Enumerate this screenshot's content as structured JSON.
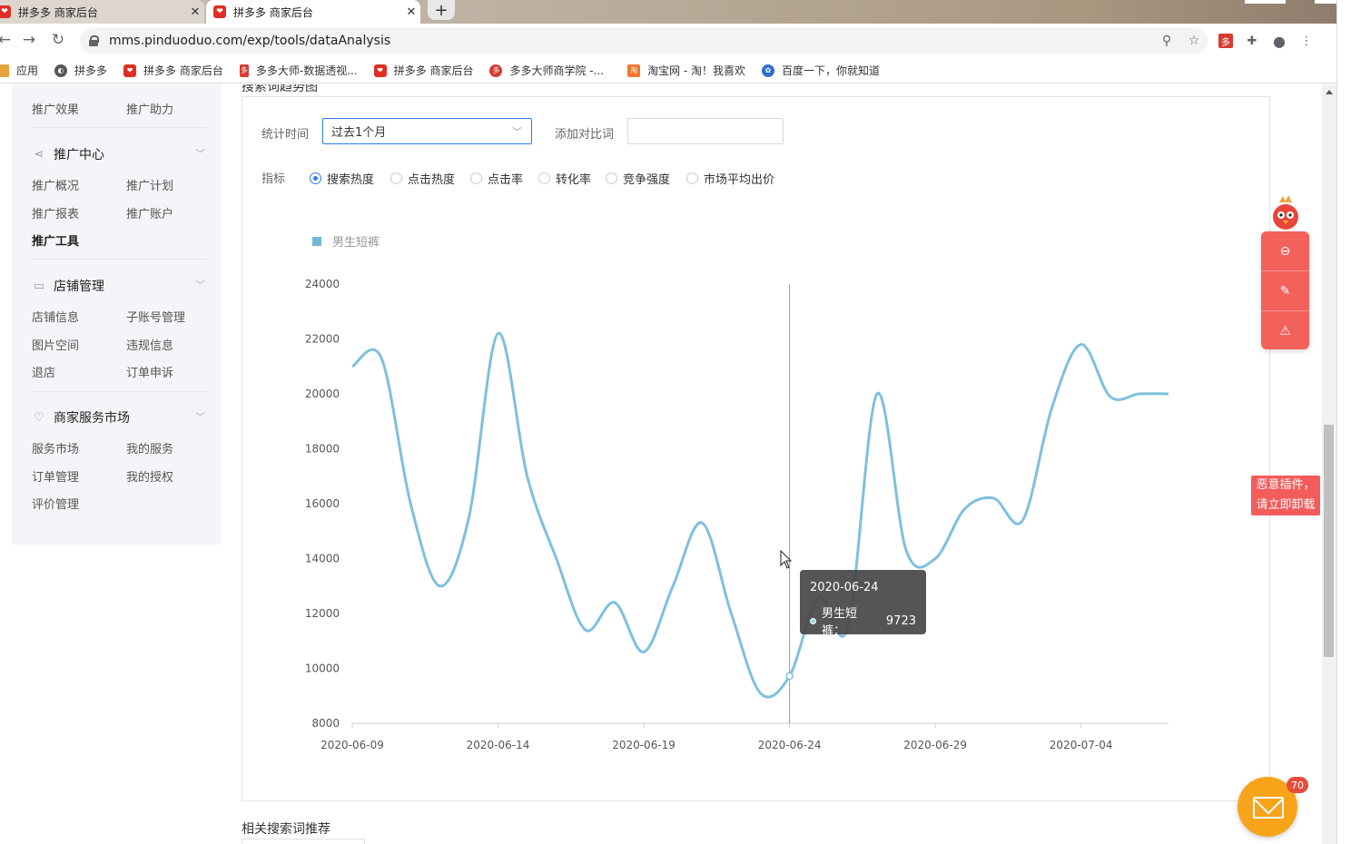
{
  "browser": {
    "tabs": [
      {
        "title": "拼多多 商家后台",
        "active": false
      },
      {
        "title": "拼多多 商家后台",
        "active": true
      }
    ],
    "new_tab": "+",
    "url": "mms.pinduoduo.com/exp/tools/dataAnalysis",
    "bookmarks": [
      {
        "label": "应用",
        "icon": "apps-grid-icon",
        "color": "#e8a33d"
      },
      {
        "label": "拼多多",
        "icon": "globe-icon",
        "color": "#555555"
      },
      {
        "label": "拼多多 商家后台",
        "icon": "pdd-icon",
        "color": "#e02e24"
      },
      {
        "label": "多多大师-数据透视...",
        "icon": "duoduo-master-icon",
        "color": "#d43c33"
      },
      {
        "label": "拼多多 商家后台",
        "icon": "pdd-icon",
        "color": "#e02e24"
      },
      {
        "label": "多多大师商学院 -...",
        "icon": "academy-icon",
        "color": "#d43c33"
      },
      {
        "label": "淘宝网 - 淘！我喜欢",
        "icon": "taobao-icon",
        "color": "#f5742d"
      },
      {
        "label": "百度一下，你就知道",
        "icon": "baidu-paw-icon",
        "color": "#2e6cd1"
      }
    ]
  },
  "sidebar": {
    "top_items": [
      "推广效果",
      "推广助力"
    ],
    "groups": [
      {
        "title": "推广中心",
        "icon": "share-icon",
        "items": [
          "推广概况",
          "推广计划",
          "推广报表",
          "推广账户",
          "推广工具"
        ],
        "active": "推广工具"
      },
      {
        "title": "店铺管理",
        "icon": "store-icon",
        "items": [
          "店铺信息",
          "子账号管理",
          "图片空间",
          "违规信息",
          "退店",
          "订单申诉"
        ]
      },
      {
        "title": "商家服务市场",
        "icon": "heart-icon",
        "items": [
          "服务市场",
          "我的服务",
          "订单管理",
          "我的授权",
          "评价管理"
        ]
      }
    ]
  },
  "content": {
    "section_title": "搜索词趋势图",
    "time_label": "统计时间",
    "time_value": "过去1个月",
    "compare_label": "添加对比词",
    "compare_value": "",
    "metric_label": "指标",
    "metrics": [
      "搜索热度",
      "点击热度",
      "点击率",
      "转化率",
      "竞争强度",
      "市场平均出价"
    ],
    "metric_selected": "搜索热度",
    "related_title": "相关搜索词推荐"
  },
  "chart_data": {
    "type": "line",
    "series": [
      {
        "name": "男生短裤",
        "color": "#7ec0de",
        "x": [
          "2020-06-09",
          "2020-06-10",
          "2020-06-11",
          "2020-06-12",
          "2020-06-13",
          "2020-06-14",
          "2020-06-15",
          "2020-06-16",
          "2020-06-17",
          "2020-06-18",
          "2020-06-19",
          "2020-06-20",
          "2020-06-21",
          "2020-06-22",
          "2020-06-23",
          "2020-06-24",
          "2020-06-25",
          "2020-06-26",
          "2020-06-27",
          "2020-06-28",
          "2020-06-29",
          "2020-06-30",
          "2020-07-01",
          "2020-07-02",
          "2020-07-03",
          "2020-07-04",
          "2020-07-05",
          "2020-07-06",
          "2020-07-07"
        ],
        "values": [
          21000,
          21300,
          16000,
          13000,
          15500,
          22200,
          17000,
          14000,
          11400,
          12400,
          10600,
          13000,
          15300,
          12000,
          9100,
          9723,
          12600,
          11500,
          20000,
          14300,
          14000,
          15800,
          16200,
          15400,
          19500,
          21800,
          19900,
          20000,
          20000
        ]
      }
    ],
    "x_ticks": [
      "2020-06-09",
      "2020-06-14",
      "2020-06-19",
      "2020-06-24",
      "2020-06-29",
      "2020-07-04"
    ],
    "y_ticks": [
      8000,
      10000,
      12000,
      14000,
      16000,
      18000,
      20000,
      22000,
      24000
    ],
    "ylim": [
      8000,
      24000
    ],
    "legend": "top-left",
    "tooltip": {
      "date": "2020-06-24",
      "label": "男生短裤：",
      "value": "9723",
      "index": 15
    }
  },
  "widgets": {
    "warning": [
      "恶意插件，",
      "请立即卸载"
    ],
    "mail_count": "70",
    "accent": "#f2615a",
    "mail_color": "#f7a41b"
  }
}
